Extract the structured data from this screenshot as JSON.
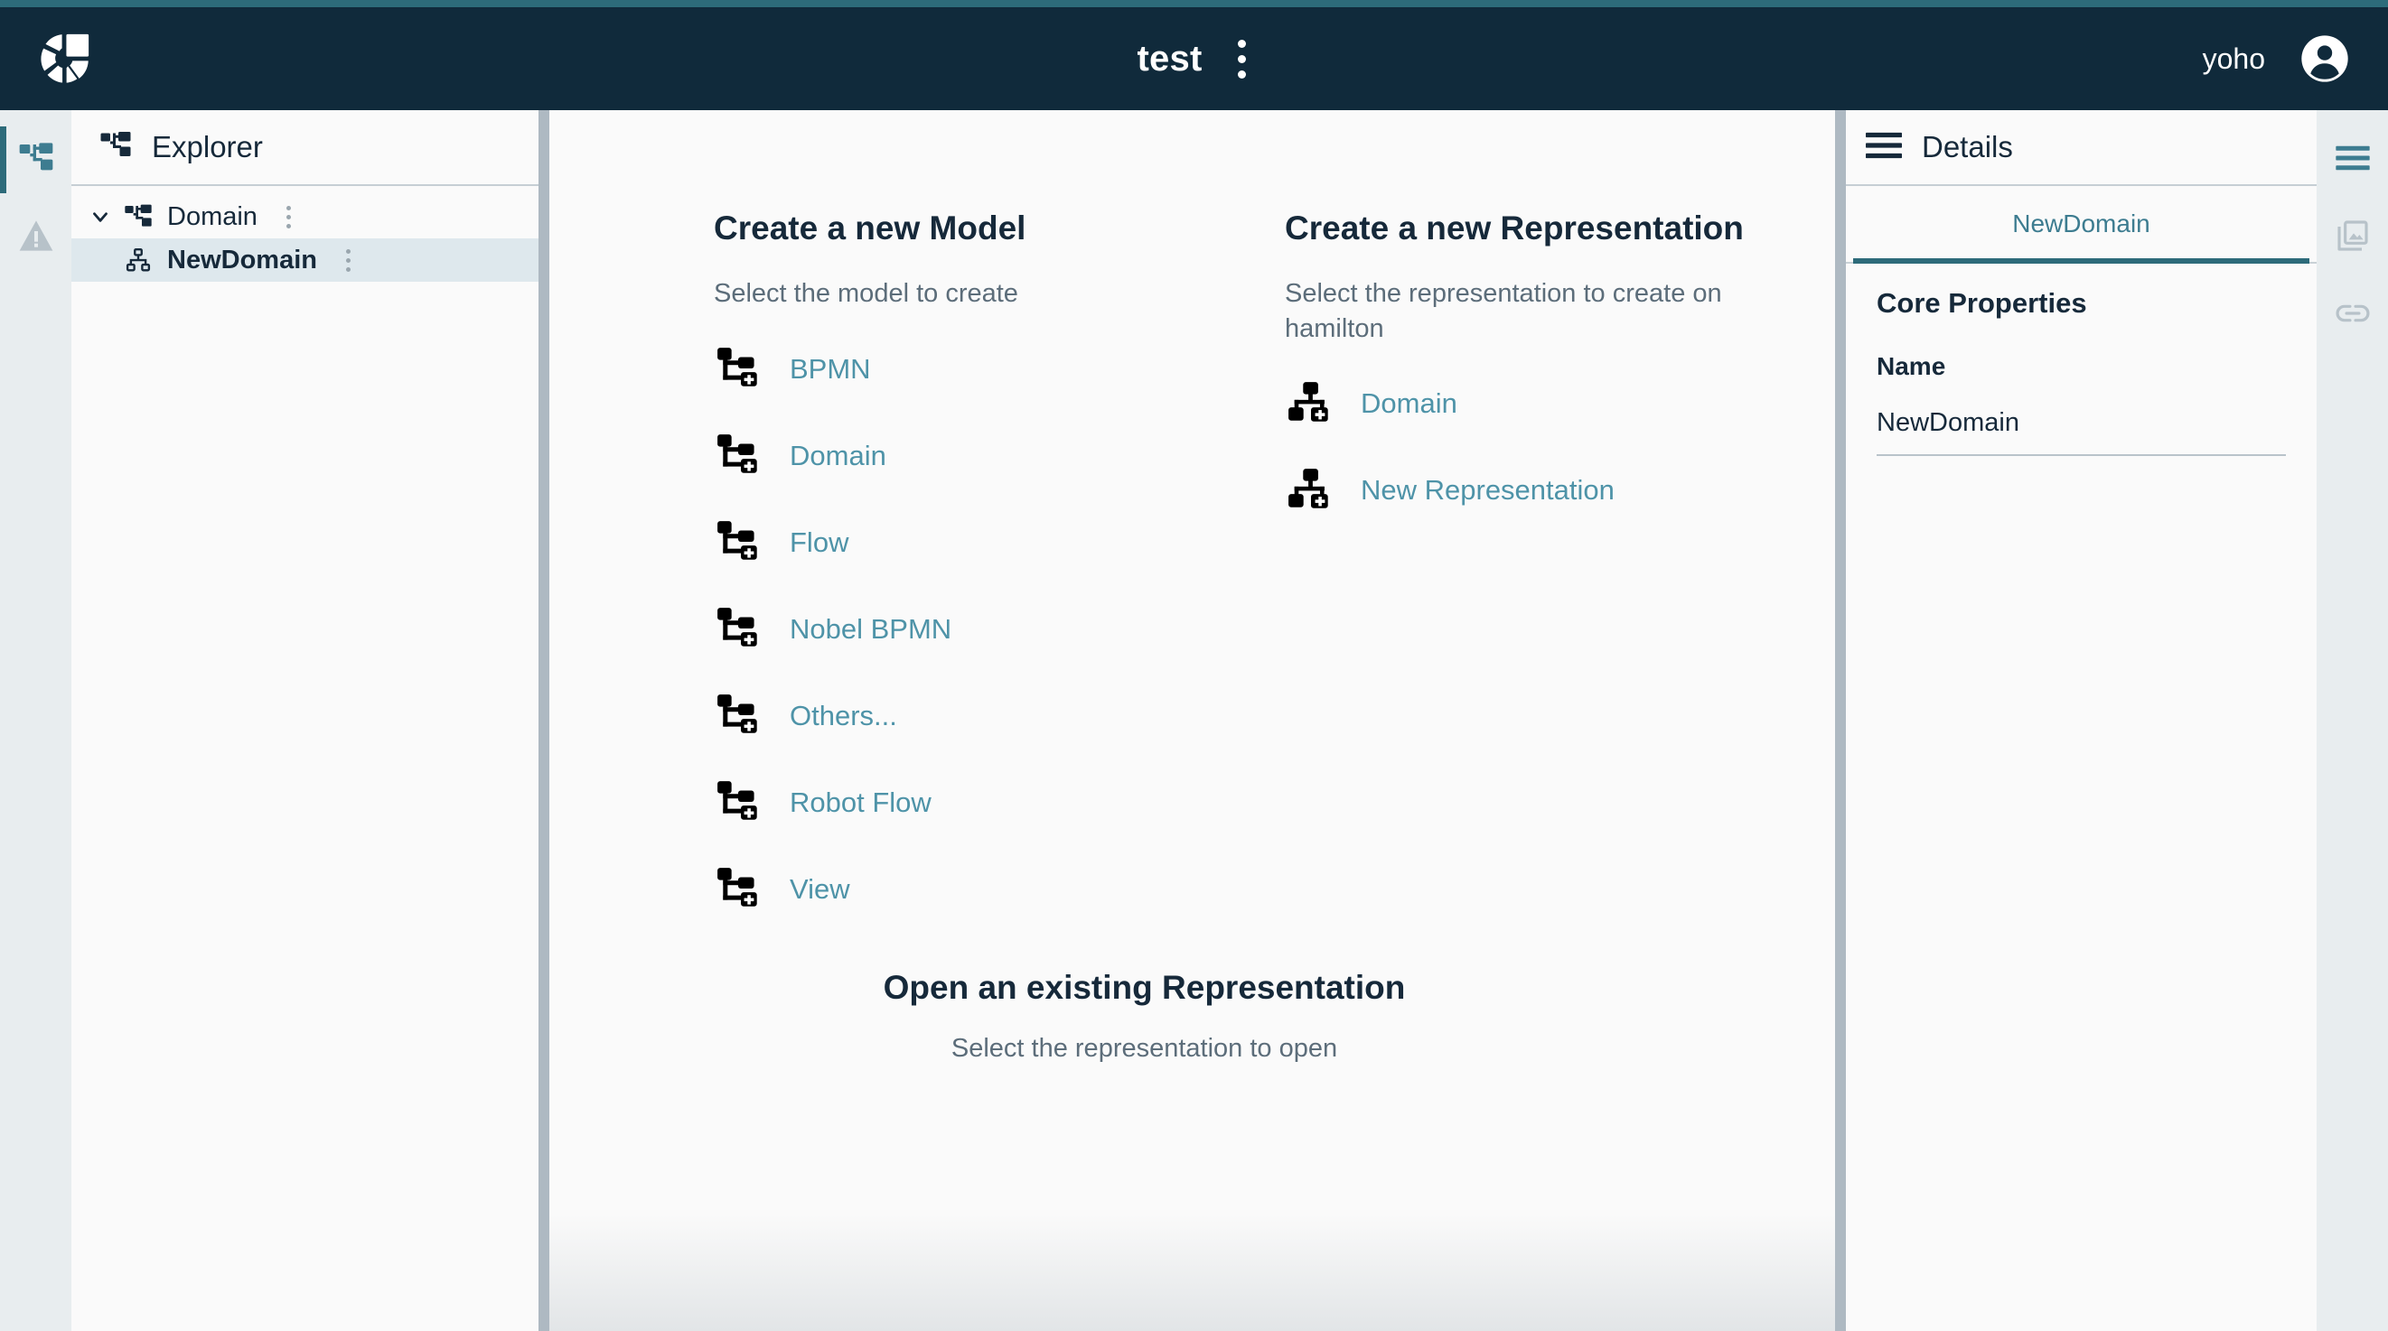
{
  "header": {
    "logo_icon": "sirius-pie-logo",
    "title": "test",
    "menu_icon": "kebab-menu-icon",
    "user_name": "yoho",
    "avatar_icon": "account-circle-icon"
  },
  "left_rail": {
    "items": [
      {
        "icon": "explorer-tree-icon",
        "active": true
      },
      {
        "icon": "validation-warning-icon",
        "active": false
      }
    ]
  },
  "explorer": {
    "icon": "explorer-tree-icon",
    "title": "Explorer",
    "tree": [
      {
        "label": "Domain",
        "icon": "document-tree-icon",
        "expanded": true,
        "selected": false,
        "depth": 0,
        "menu_icon": "kebab-menu-icon"
      },
      {
        "label": "NewDomain",
        "icon": "hierarchy-icon",
        "expanded": false,
        "selected": true,
        "depth": 1,
        "menu_icon": "kebab-menu-icon"
      }
    ]
  },
  "main": {
    "create_model": {
      "title": "Create a new Model",
      "subtitle": "Select the model to create",
      "items": [
        {
          "label": "BPMN",
          "icon": "new-model-tree-icon"
        },
        {
          "label": "Domain",
          "icon": "new-model-tree-icon"
        },
        {
          "label": "Flow",
          "icon": "new-model-tree-icon"
        },
        {
          "label": "Nobel BPMN",
          "icon": "new-model-tree-icon"
        },
        {
          "label": "Others...",
          "icon": "new-model-tree-icon"
        },
        {
          "label": "Robot Flow",
          "icon": "new-model-tree-icon"
        },
        {
          "label": "View",
          "icon": "new-model-tree-icon"
        }
      ]
    },
    "create_representation": {
      "title": "Create a new Representation",
      "subtitle": "Select the representation to create on hamilton",
      "items": [
        {
          "label": "Domain",
          "icon": "new-representation-hierarchy-icon"
        },
        {
          "label": "New Representation",
          "icon": "new-representation-hierarchy-icon"
        }
      ]
    },
    "open_representation": {
      "title": "Open an existing Representation",
      "subtitle": "Select the representation to open"
    }
  },
  "details": {
    "menu_icon": "hamburger-icon",
    "title": "Details",
    "tabs": [
      {
        "label": "NewDomain",
        "active": true
      }
    ],
    "section_title": "Core Properties",
    "fields": [
      {
        "label": "Name",
        "value": "NewDomain"
      }
    ]
  },
  "right_rail": {
    "items": [
      {
        "icon": "hamburger-icon",
        "active": true
      },
      {
        "icon": "representations-gallery-icon",
        "active": false
      },
      {
        "icon": "related-elements-link-icon",
        "active": false
      }
    ]
  },
  "colors": {
    "header_bg": "#102a3b",
    "accent_teal": "#2d6b7a",
    "link_teal": "#4e93a8",
    "rail_bg": "#e8edef",
    "selection_bg": "#dee8ed",
    "text_dark": "#16293a",
    "text_muted": "#5c6d7a"
  }
}
